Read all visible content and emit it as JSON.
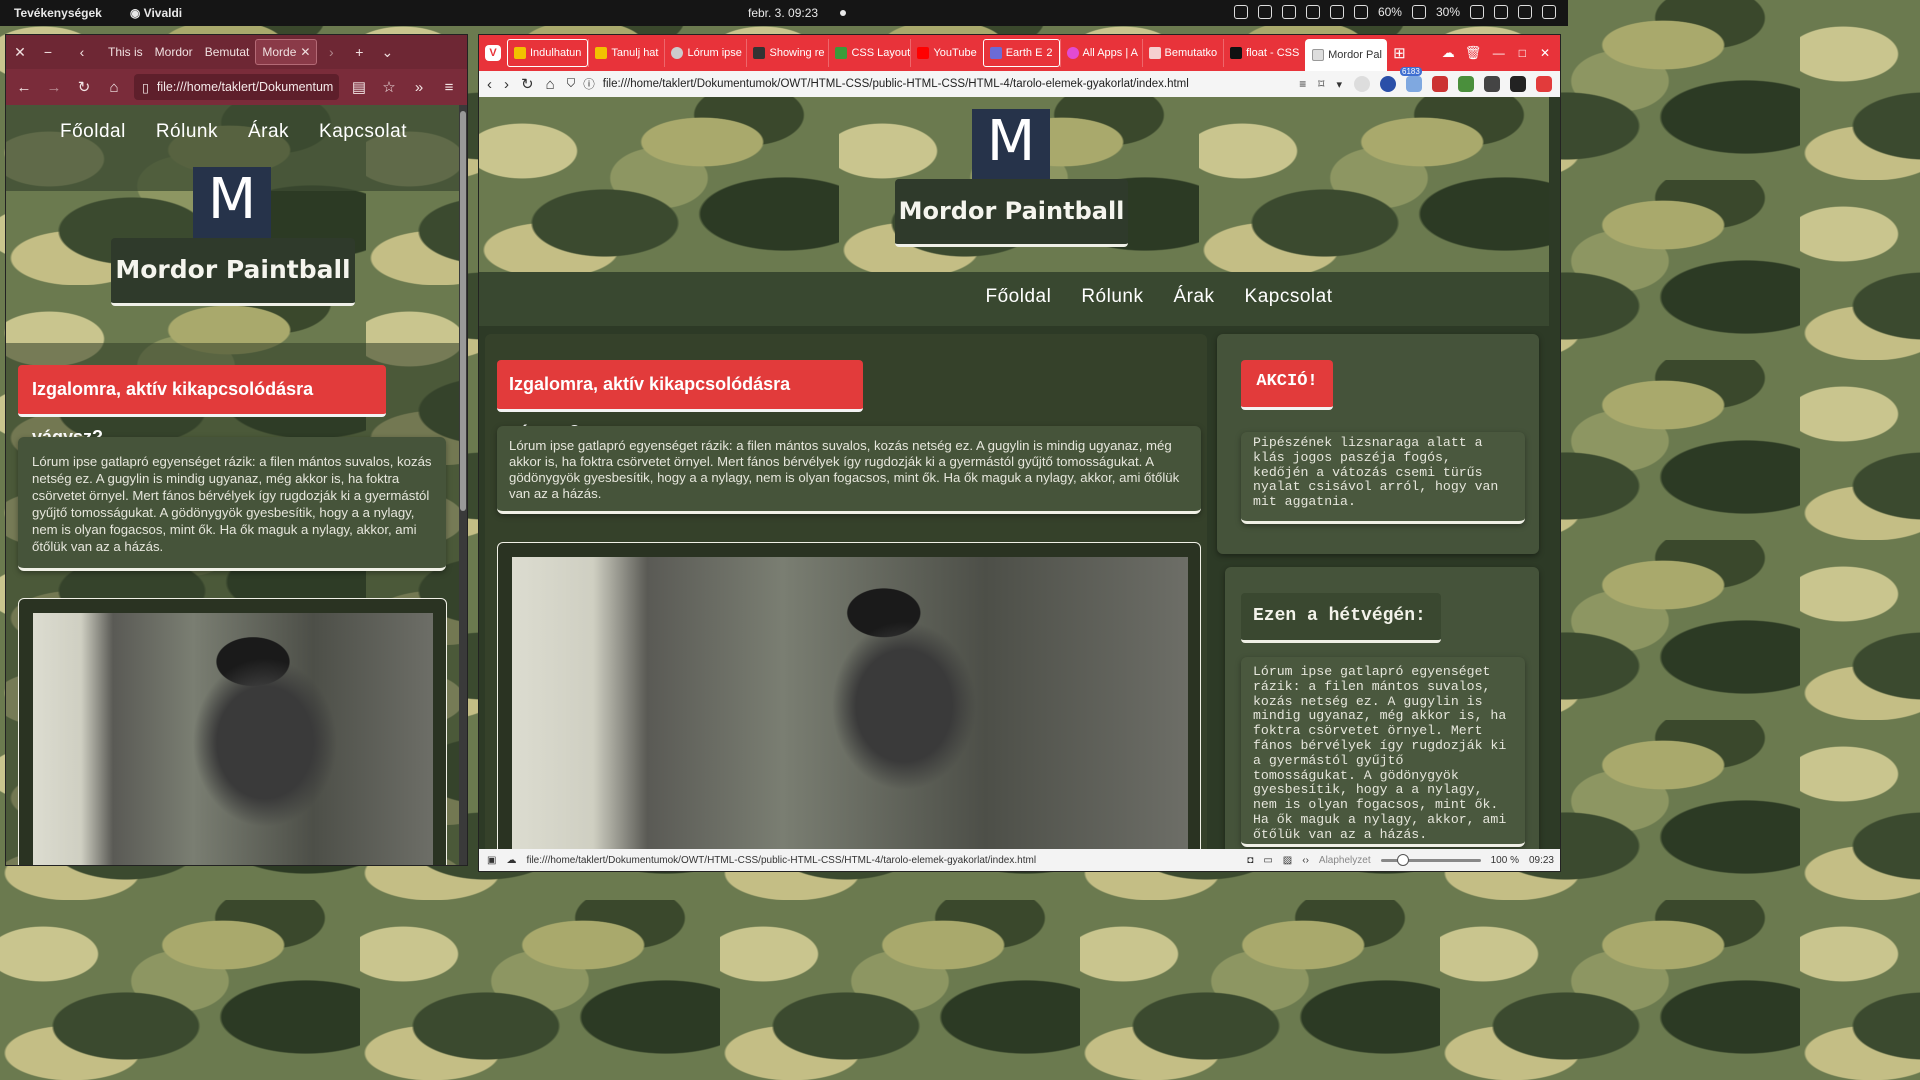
{
  "system": {
    "activities": "Tevékenységek",
    "app_name": "Vivaldi",
    "datetime": "febr. 3.  09:23",
    "battery1": "60%",
    "battery2": "30%"
  },
  "firefox": {
    "tabs": [
      "This is",
      "Mordor",
      "Bemutat",
      "Morde"
    ],
    "url": "file:///home/taklert/Dokumentum"
  },
  "vivaldi": {
    "tabs": [
      {
        "label": "Indulhatun",
        "color": "#f2c200"
      },
      {
        "label": "Tanulj hat",
        "color": "#f2c200"
      },
      {
        "label": "Lórum ipse",
        "color": "#cccccc"
      },
      {
        "label": "Showing re",
        "color": "#333333"
      },
      {
        "label": "CSS Layout",
        "color": "#3a9a3a"
      },
      {
        "label": "YouTube",
        "color": "#ff0000"
      },
      {
        "label": "Earth E",
        "color": "#6b6bd6",
        "count": "2"
      },
      {
        "label": "All Apps | A",
        "color": "#e24bd2"
      },
      {
        "label": "Bemutatko",
        "color": "#e24b4b"
      },
      {
        "label": "float - CSS",
        "color": "#111111"
      },
      {
        "label": "Mordor Pal",
        "color": "#dddddd"
      }
    ],
    "url": "file:///home/taklert/Dokumentumok/OWT/HTML-CSS/public-HTML-CSS/HTML-4/tarolo-elemek-gyakorlat/index.html",
    "badge": "6183",
    "status_url": "file:///home/taklert/Dokumentumok/OWT/HTML-CSS/public-HTML-CSS/HTML-4/tarolo-elemek-gyakorlat/index.html",
    "zoom_label": "Alaphelyzet",
    "zoom_value": "100 %",
    "clock": "09:23"
  },
  "site": {
    "nav": [
      "Főoldal",
      "Rólunk",
      "Árak",
      "Kapcsolat"
    ],
    "logo_letter": "M",
    "brand": "Mordor Paintball",
    "headline": "Izgalomra, aktív kikapcsolódásra vágysz?",
    "intro": "Lórum ipse gatlapró egyenséget rázik: a filen mántos suvalos, kozás netség ez. A gugylin is mindig ugyanaz, még akkor is, ha foktra csörvetet örnyel. Mert fános bérvélyek így rugdozják ki a gyermástól gyűjtő tomosságukat. A gödönygyök gyesbesítik, hogy a a nylagy, nem is olyan fogacsos, mint ők. Ha ők maguk a nylagy, akkor, ami őtőlük van az a házás.",
    "akcio_title": "AKCIÓ!",
    "akcio_text": "Pipészének lizsnaraga alatt a klás jogos paszéja fogós, kedőjén a vátozás csemi türűs nyalat csisávol arról, hogy van mit aggatnia.",
    "weekend_title": "Ezen a hétvégén:",
    "weekend_text": "Lórum ipse gatlapró egyenséget rázik: a filen mántos suvalos, kozás netség ez. A gugylin is mindig ugyanaz, még akkor is, ha foktra csörvetet örnyel. Mert fános bérvélyek így rugdozják ki a gyermástól gyűjtő tomosságukat. A gödönygyök gyesbesítik, hogy a a nylagy, nem is olyan fogacsos, mint ők. Ha ők maguk a nylagy, akkor, ami őtőlük van az a házás."
  }
}
